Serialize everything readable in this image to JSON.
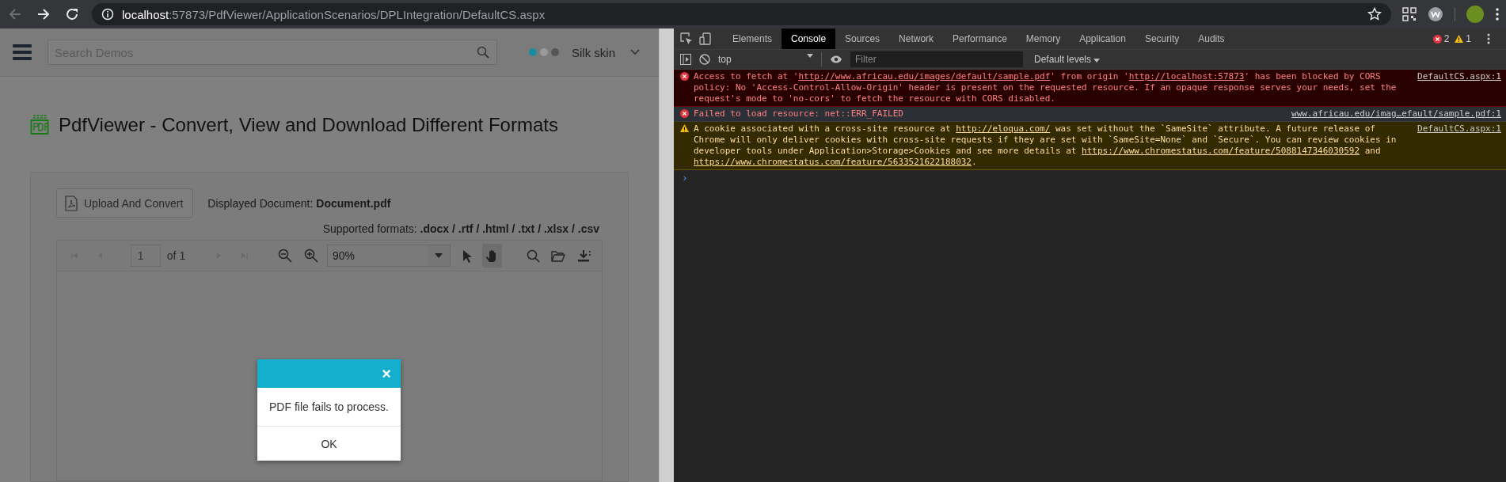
{
  "browser": {
    "back": {
      "disabled": true
    },
    "url": "**localhost**:57873/PdfViewer/ApplicationScenarios/DPLIntegration/DefaultCS.aspx"
  },
  "app": {
    "search": {
      "placeholder": "Search Demos"
    },
    "skin": {
      "label": "Silk skin",
      "dots": [
        {
          "color": "#1a8b9c"
        },
        {
          "color": "#9a9a9a"
        },
        {
          "color": "#555555"
        }
      ]
    },
    "title": "PdfViewer - Convert, View and Download Different Formats",
    "upload_button": "Upload And Convert",
    "displayed": "Displayed Document: **Document.pdf**",
    "supported": "Supported formats: **.docx / .rtf / .html / .txt / .xlsx / .csv**",
    "toolbar": {
      "nav": [
        {
          "kind": "first",
          "disabled": true
        },
        {
          "kind": "prev",
          "disabled": true
        }
      ],
      "page": "1",
      "page_count": "of 1",
      "nav_after": [
        {
          "kind": "next",
          "disabled": true
        },
        {
          "kind": "last",
          "disabled": true
        }
      ],
      "zoom": "90%",
      "tools": [
        {
          "kind": "select",
          "selected": false
        },
        {
          "kind": "pan",
          "selected": true
        }
      ]
    },
    "dialog": {
      "close": "×",
      "message": "PDF file fails to process.",
      "button": "OK"
    }
  },
  "devtools": {
    "tabs": [
      {
        "label": "Elements",
        "selected": false
      },
      {
        "label": "Console",
        "selected": true
      },
      {
        "label": "Sources",
        "selected": false
      },
      {
        "label": "Network",
        "selected": false
      },
      {
        "label": "Performance",
        "selected": false
      },
      {
        "label": "Memory",
        "selected": false
      },
      {
        "label": "Application",
        "selected": false
      },
      {
        "label": "Security",
        "selected": false
      },
      {
        "label": "Audits",
        "selected": false
      }
    ],
    "errors": "2",
    "warnings": "1",
    "context": "top",
    "filter": {
      "placeholder": "Filter"
    },
    "levels": "Default levels",
    "messages": [
      {
        "kind": "error",
        "source": "DefaultCS.aspx:1",
        "parts": [
          {
            "text": "Access to fetch at '"
          },
          {
            "text": "http://www.africau.edu/images/default/sample.pdf",
            "link": true
          },
          {
            "text": "' from origin '"
          },
          {
            "text": "http://localhost:57873",
            "link": true
          },
          {
            "text": "' has been blocked by CORS policy: No 'Access-Control-Allow-Origin' header is present on the requested resource. If an opaque response serves your needs, set the request's mode to 'no-cors' to fetch the resource with CORS disabled."
          }
        ]
      },
      {
        "kind": "error_selected",
        "source": "www.africau.edu/imag…efault/sample.pdf:1",
        "parts": [
          {
            "text": "Failed to load resource: net::ERR_FAILED"
          }
        ]
      },
      {
        "kind": "warning",
        "source": "DefaultCS.aspx:1",
        "parts": [
          {
            "text": "A cookie associated with a cross-site resource at "
          },
          {
            "text": "http://eloqua.com/",
            "link": true
          },
          {
            "text": " was set without the `SameSite` attribute. A future release of Chrome will only deliver cookies with cross-site requests if they are set with `SameSite=None` and `Secure`. You can review cookies in developer tools under Application>Storage>Cookies and see more details at "
          },
          {
            "text": "https://www.chromestatus.com/feature/5088147346030592",
            "link": true
          },
          {
            "text": " and "
          },
          {
            "text": "https://www.chromestatus.com/feature/5633521622188032",
            "link": true
          },
          {
            "text": "."
          }
        ]
      }
    ],
    "prompt": "›"
  }
}
